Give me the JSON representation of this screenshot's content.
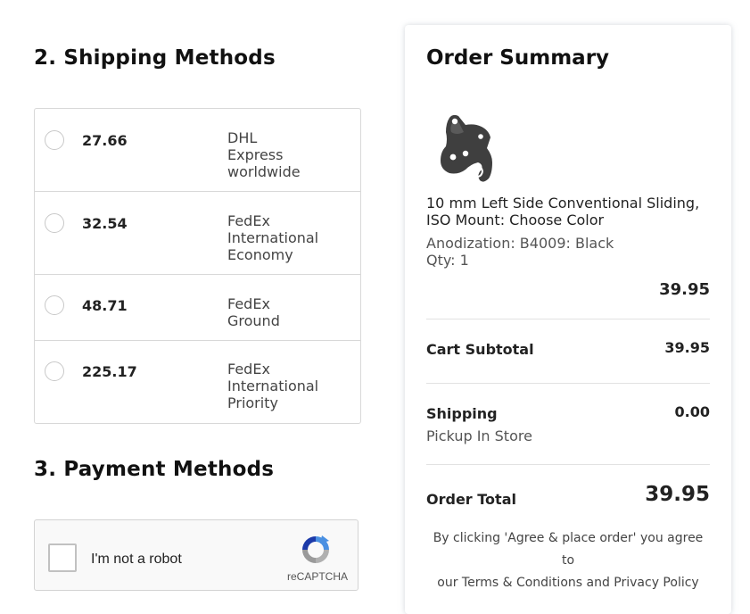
{
  "shipping": {
    "heading": "2. Shipping Methods",
    "options": [
      {
        "price": "27.66",
        "carrier": [
          "DHL",
          "Express",
          "worldwide"
        ]
      },
      {
        "price": "32.54",
        "carrier": [
          "FedEx",
          "International",
          "Economy"
        ]
      },
      {
        "price": "48.71",
        "carrier": [
          "FedEx",
          "Ground"
        ]
      },
      {
        "price": "225.17",
        "carrier": [
          "FedEx",
          "International",
          "Priority"
        ]
      }
    ]
  },
  "payment": {
    "heading": "3. Payment Methods",
    "captcha_label": "I'm not a robot",
    "captcha_brand": "reCAPTCHA"
  },
  "summary": {
    "title": "Order Summary",
    "product": {
      "image_icon": "bike-dropout-part-icon",
      "name": "10 mm Left Side Conventional Sliding, ISO Mount: Choose Color",
      "variant": "Anodization: B4009: Black",
      "qty": "Qty: 1",
      "price": "39.95"
    },
    "subtotal_label": "Cart Subtotal",
    "subtotal_value": "39.95",
    "shipping_label": "Shipping",
    "shipping_value": "0.00",
    "shipping_method": "Pickup In Store",
    "total_label": "Order Total",
    "total_value": "39.95",
    "terms_line1": "By clicking 'Agree & place order' you agree to",
    "terms_line2": "our Terms & Conditions and Privacy Policy"
  },
  "colors": {
    "border": "#d8d8d8",
    "text": "#1a1a1a",
    "muted": "#555555",
    "recaptcha_blue": "#4a90e2",
    "recaptcha_grey": "#b0b0b0"
  }
}
